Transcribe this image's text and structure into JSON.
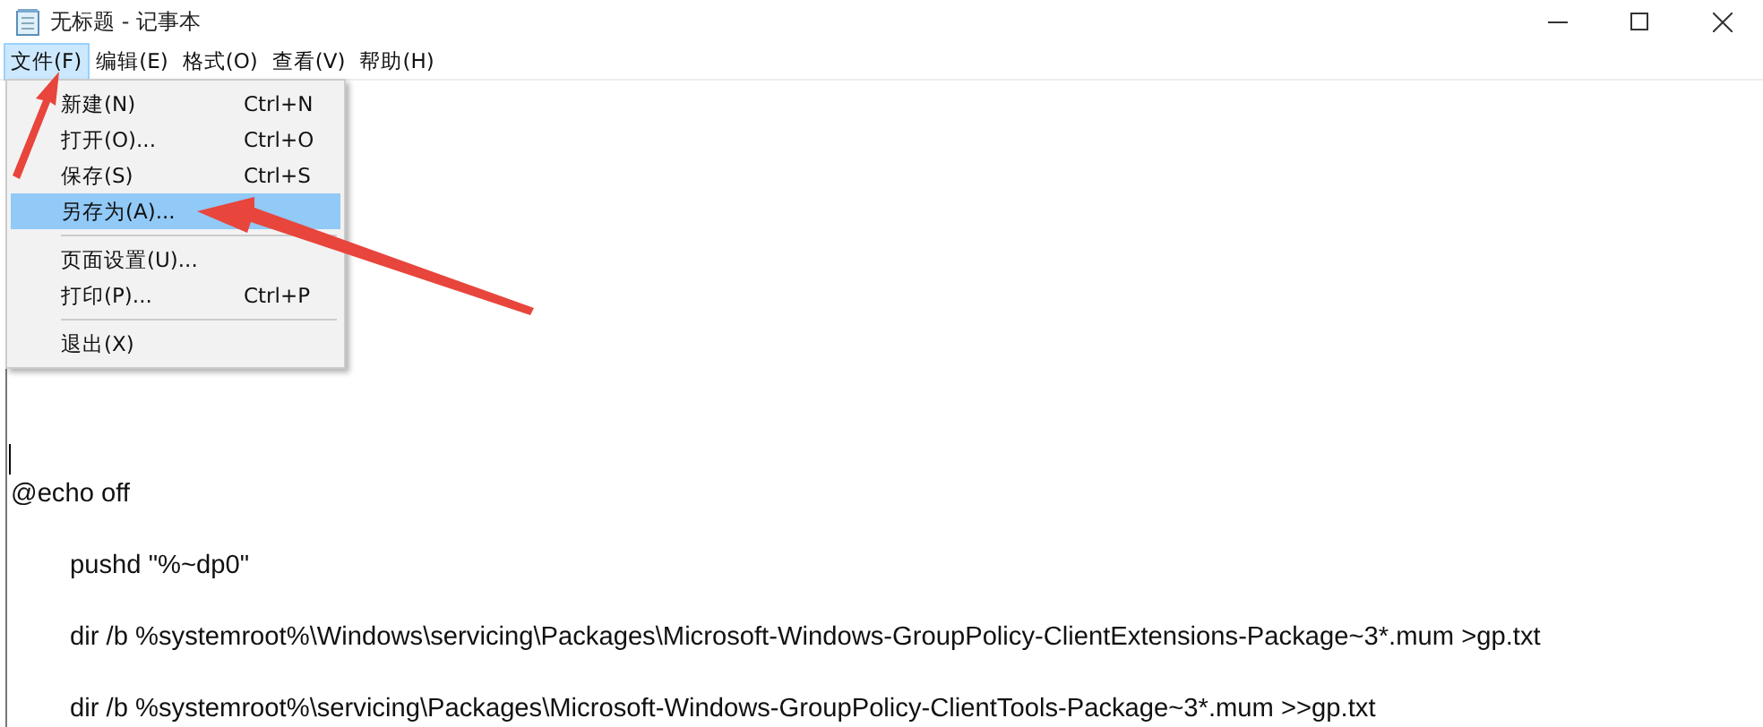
{
  "window": {
    "title": "无标题 - 记事本",
    "controls": [
      {
        "kind": "minimize"
      },
      {
        "kind": "maximize"
      },
      {
        "kind": "close"
      }
    ]
  },
  "menu_bar": [
    {
      "label": "文件(F)",
      "selected": true
    },
    {
      "label": "编辑(E)",
      "selected": false
    },
    {
      "label": "格式(O)",
      "selected": false
    },
    {
      "label": "查看(V)",
      "selected": false
    },
    {
      "label": "帮助(H)",
      "selected": false
    }
  ],
  "file_menu": [
    {
      "kind": "item",
      "label": "新建(N)",
      "shortcut": "Ctrl+N",
      "selected": false
    },
    {
      "kind": "item",
      "label": "打开(O)...",
      "shortcut": "Ctrl+O",
      "selected": false
    },
    {
      "kind": "item",
      "label": "保存(S)",
      "shortcut": "Ctrl+S",
      "selected": false
    },
    {
      "kind": "item",
      "label": "另存为(A)...",
      "selected": true
    },
    {
      "kind": "separator"
    },
    {
      "kind": "item",
      "label": "页面设置(U)...",
      "selected": false
    },
    {
      "kind": "item",
      "label": "打印(P)...",
      "shortcut": "Ctrl+P",
      "selected": false
    },
    {
      "kind": "separator"
    },
    {
      "kind": "item",
      "label": "退出(X)",
      "selected": false
    }
  ],
  "editor": {
    "lines": [
      {
        "text": "@echo off",
        "indented": false
      },
      {
        "text": "pushd \"%~dp0\"",
        "indented": true
      },
      {
        "text": "dir /b %systemroot%\\Windows\\servicing\\Packages\\Microsoft-Windows-GroupPolicy-ClientExtensions-Package~3*.mum >gp.txt",
        "indented": true
      },
      {
        "text": "dir /b  %systemroot%\\servicing\\Packages\\Microsoft-Windows-GroupPolicy-ClientTools-Package~3*.mum >>gp.txt",
        "indented": true
      }
    ]
  }
}
